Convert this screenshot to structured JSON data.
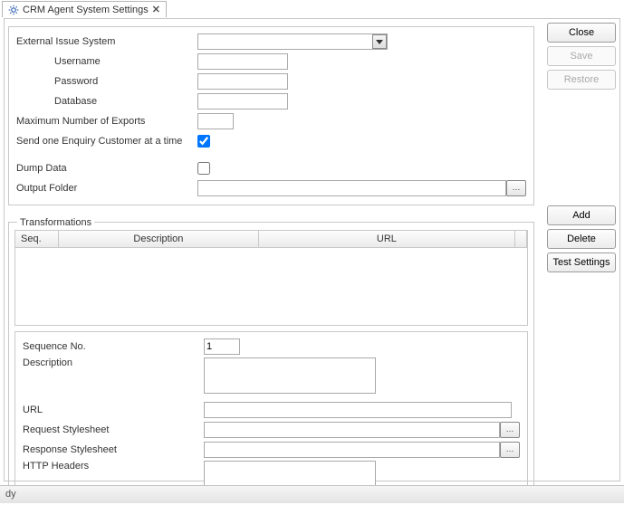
{
  "tab": {
    "title": "CRM Agent System Settings"
  },
  "buttons": {
    "close": "Close",
    "save": "Save",
    "restore": "Restore",
    "add": "Add",
    "delete": "Delete",
    "test": "Test Settings"
  },
  "form": {
    "external_issue_system_label": "External Issue System",
    "external_issue_system_value": "",
    "username_label": "Username",
    "username_value": "",
    "password_label": "Password",
    "password_value": "",
    "database_label": "Database",
    "database_value": "",
    "max_exports_label": "Maximum Number of Exports",
    "max_exports_value": "",
    "send_one_label": "Send one Enquiry Customer at a time",
    "send_one_checked": true,
    "dump_data_label": "Dump Data",
    "dump_data_checked": false,
    "output_folder_label": "Output Folder",
    "output_folder_value": ""
  },
  "transformations": {
    "group_label": "Transformations",
    "columns": {
      "seq": "Seq.",
      "description": "Description",
      "url": "URL"
    },
    "rows": []
  },
  "detail": {
    "sequence_label": "Sequence No.",
    "sequence_value": "1",
    "description_label": "Description",
    "description_value": "",
    "url_label": "URL",
    "url_value": "",
    "request_stylesheet_label": "Request Stylesheet",
    "request_stylesheet_value": "",
    "response_stylesheet_label": "Response Stylesheet",
    "response_stylesheet_value": "",
    "http_headers_label": "HTTP Headers",
    "http_headers_value": ""
  },
  "status": {
    "text": "dy"
  }
}
